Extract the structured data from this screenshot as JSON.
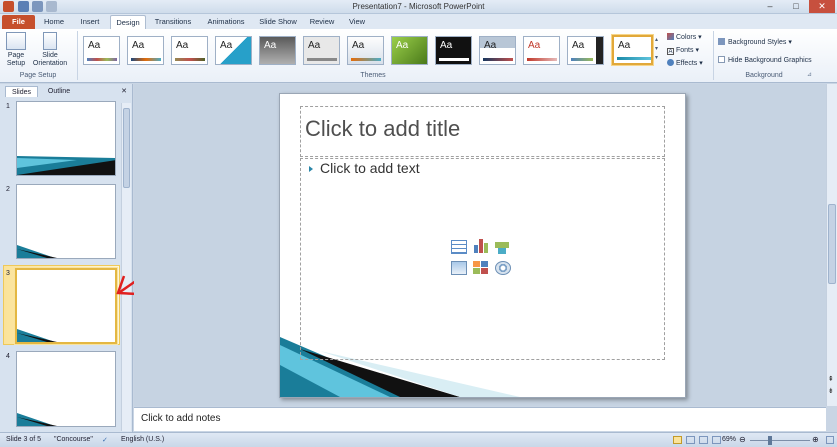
{
  "window": {
    "title": "Presentation7 - Microsoft PowerPoint",
    "min": "–",
    "max": "□",
    "close": "✕"
  },
  "tabs": [
    "File",
    "Home",
    "Insert",
    "Design",
    "Transitions",
    "Animations",
    "Slide Show",
    "Review",
    "View"
  ],
  "ribbon": {
    "page_setup": {
      "page_setup_label": "Page Setup",
      "orientation_label": "Slide Orientation",
      "group_label": "Page Setup"
    },
    "themes": {
      "group_label": "Themes",
      "sample": "Aa"
    },
    "theme_options": {
      "colors": "Colors",
      "fonts": "Fonts",
      "effects": "Effects"
    },
    "background": {
      "styles": "Background Styles",
      "hide": "Hide Background Graphics",
      "group_label": "Background"
    }
  },
  "panel": {
    "tab_slides": "Slides",
    "tab_outline": "Outline",
    "close": "✕",
    "slides": [
      "1",
      "2",
      "3",
      "4"
    ]
  },
  "slide": {
    "title_placeholder": "Click to add title",
    "body_placeholder": "Click to add text"
  },
  "notes": {
    "placeholder": "Click to add notes"
  },
  "status": {
    "slide_info": "Slide 3 of 5",
    "theme_name": "\"Concourse\"",
    "language": "English (U.S.)",
    "zoom": "69%"
  },
  "colors": {
    "accent": "#c64f2c",
    "selection": "#e4b742",
    "arrow": "#e02020",
    "teal": "#1b8aa8"
  }
}
